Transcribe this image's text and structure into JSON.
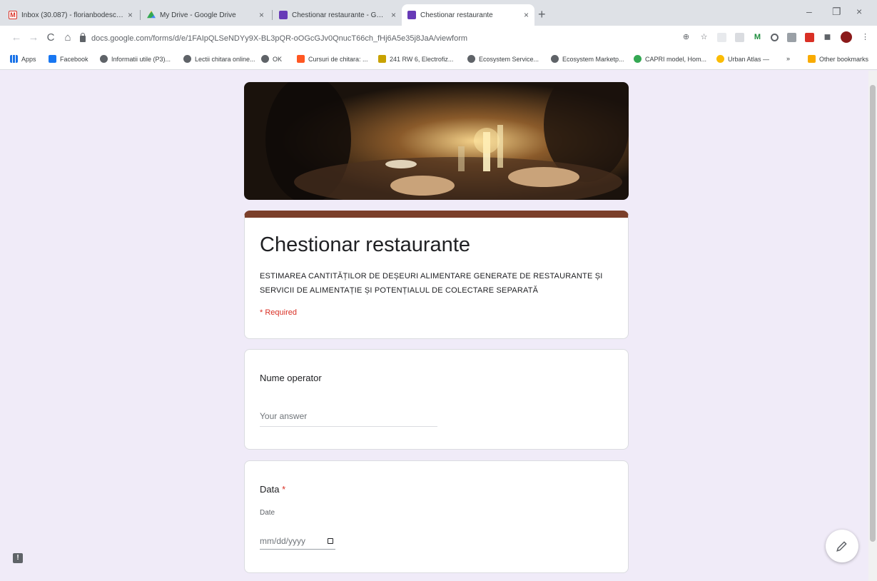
{
  "tabs": [
    {
      "title": "Inbox (30.087) - florianbodescu@...",
      "close": "×"
    },
    {
      "title": "My Drive - Google Drive",
      "close": "×"
    },
    {
      "title": "Chestionar restaurante - Google...",
      "close": "×"
    },
    {
      "title": "Chestionar restaurante",
      "close": "×"
    }
  ],
  "newtab": "+",
  "window": {
    "minimize": "–",
    "maximize": "❐",
    "close": "×"
  },
  "nav": {
    "back": "←",
    "forward": "→",
    "reload": "C",
    "home": "⌂"
  },
  "address": "docs.google.com/forms/d/e/1FAIpQLSeNDYy9X-BL3pQR-oOGcGJv0QnucT66ch_fHj6A5e35j8JaA/viewform",
  "bookmarks": [
    {
      "label": "Apps"
    },
    {
      "label": "Facebook"
    },
    {
      "label": "Informatii utile (P3)..."
    },
    {
      "label": "Lectii chitara online..."
    },
    {
      "label": "OK"
    },
    {
      "label": "Cursuri de chitara: ..."
    },
    {
      "label": "241 RW 6, Electrofiz..."
    },
    {
      "label": "Ecosystem Service..."
    },
    {
      "label": "Ecosystem Marketp..."
    },
    {
      "label": "CAPRI model, Hom..."
    },
    {
      "label": "Urban Atlas —"
    },
    {
      "label": "»"
    },
    {
      "label": "Other bookmarks"
    }
  ],
  "form": {
    "title": "Chestionar restaurante",
    "description": "ESTIMAREA CANTITĂȚILOR DE DEȘEURI ALIMENTARE GENERATE DE RESTAURANTE ȘI SERVICII DE ALIMENTAȚIE ȘI POTENȚIALUL DE COLECTARE SEPARATĂ",
    "required_note": "* Required",
    "q1": {
      "label": "Nume operator",
      "placeholder": "Your answer"
    },
    "q2": {
      "label": "Data",
      "star": "*",
      "sublabel": "Date",
      "placeholder": "mm/dd/yyyy"
    }
  },
  "colors": {
    "theme": "#7b3f2a",
    "background": "#f0ebf8",
    "required": "#d93025"
  },
  "icons": {
    "feedback": "!",
    "edit": "pencil-icon"
  }
}
